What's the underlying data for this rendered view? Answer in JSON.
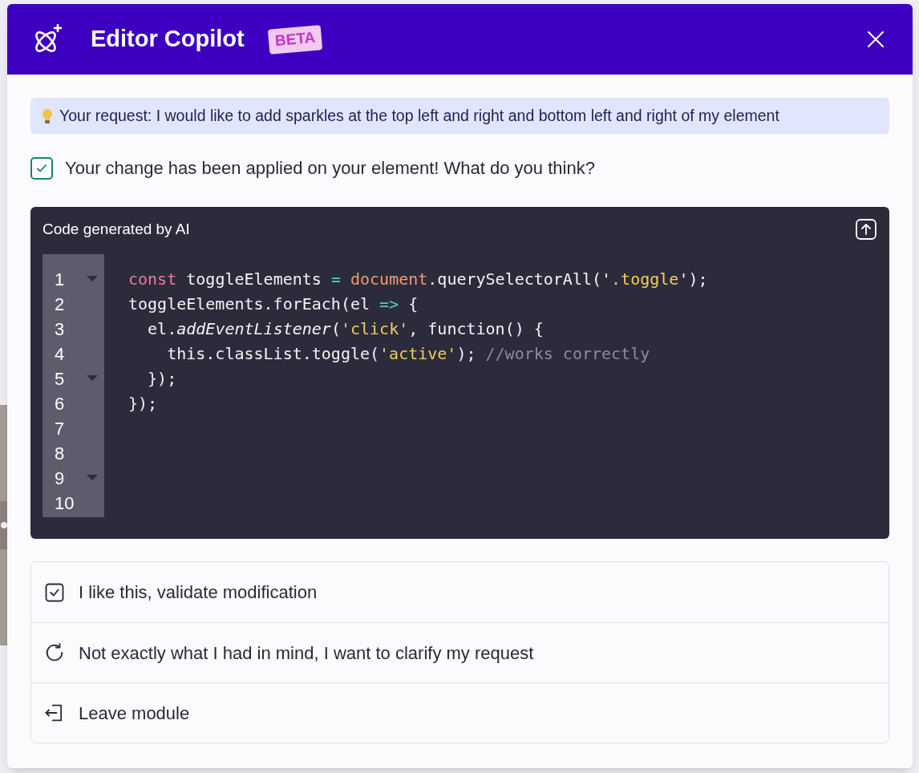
{
  "header": {
    "title": "Editor Copilot",
    "badge": "BETA"
  },
  "request": {
    "text": "Your request: I would like to add sparkles at the top left and right and bottom left and right of my element"
  },
  "status": {
    "checked": true,
    "text": "Your change has been applied on your element! What do you think?"
  },
  "code_panel": {
    "title": "Code generated by AI",
    "lines": [
      {
        "number": "1",
        "foldable": true,
        "tokens": [
          {
            "kind": "keyword",
            "text": "const"
          },
          {
            "kind": "plain",
            "text": " toggleElements "
          },
          {
            "kind": "operator",
            "text": "= "
          },
          {
            "kind": "object",
            "text": "document"
          },
          {
            "kind": "plain",
            "text": ".querySelectorAll('"
          },
          {
            "kind": "string",
            "text": ".toggle"
          },
          {
            "kind": "plain",
            "text": "');"
          }
        ]
      },
      {
        "number": "2",
        "foldable": false,
        "tokens": [
          {
            "kind": "plain",
            "text": "toggleElements.forEach(el "
          },
          {
            "kind": "operator",
            "text": "=>"
          },
          {
            "kind": "plain",
            "text": " {"
          }
        ]
      },
      {
        "number": "3",
        "foldable": false,
        "tokens": [
          {
            "kind": "plain",
            "text": "  el."
          },
          {
            "kind": "method",
            "text": "addEventListener"
          },
          {
            "kind": "plain",
            "text": "("
          },
          {
            "kind": "string",
            "text": "'click'"
          },
          {
            "kind": "plain",
            "text": ", function() {"
          }
        ]
      },
      {
        "number": "4",
        "foldable": false,
        "tokens": [
          {
            "kind": "plain",
            "text": "    this.classList.toggle("
          },
          {
            "kind": "string",
            "text": "'active'"
          },
          {
            "kind": "plain",
            "text": "); "
          },
          {
            "kind": "comment",
            "text": "//works correctly"
          }
        ]
      },
      {
        "number": "5",
        "foldable": true,
        "tokens": [
          {
            "kind": "plain",
            "text": "  });"
          }
        ]
      },
      {
        "number": "6",
        "foldable": false,
        "tokens": [
          {
            "kind": "plain",
            "text": "});"
          }
        ]
      },
      {
        "number": "7",
        "foldable": false
      },
      {
        "number": "8",
        "foldable": false
      },
      {
        "number": "9",
        "foldable": true
      },
      {
        "number": "10",
        "foldable": false
      }
    ]
  },
  "actions": [
    {
      "kind": "validate",
      "label": "I like this, validate modification"
    },
    {
      "kind": "clarify",
      "label": "Not exactly what I had in mind, I want to clarify my request"
    },
    {
      "kind": "leave",
      "label": "Leave module"
    }
  ]
}
